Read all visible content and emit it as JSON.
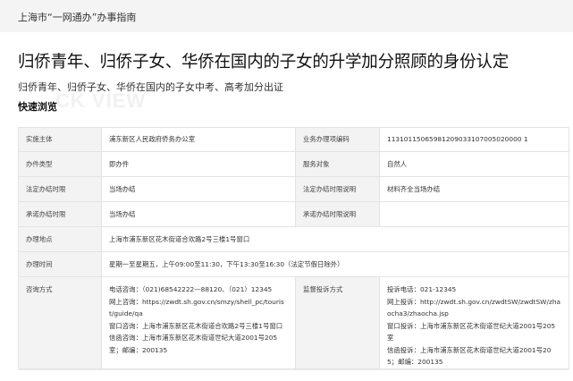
{
  "header": {
    "site_title": "上海市“一网通办”办事指南"
  },
  "page": {
    "title": "归侨青年、归侨子女、华侨在国内的子女的升学加分照顾的身份认定",
    "subtitle": "归侨青年、归侨子女、华侨在国内的子女中考、高考加分出证",
    "section_label": "快速浏览",
    "section_watermark": "CK VIEW"
  },
  "info": {
    "implementer_label": "实施主体",
    "implementer_value": "浦东新区人民政府侨务办公室",
    "code_label": "业务办理项编码",
    "code_value": "11310115065981209033107005020000 1",
    "type_label": "办件类型",
    "type_value": "即办件",
    "target_label": "服务对象",
    "target_value": "自然人",
    "legal_time_label": "法定办结时限",
    "legal_time_value": "当场办结",
    "legal_note_label": "法定办结时限说明",
    "legal_note_value": "材料齐全当场办结",
    "promise_time_label": "承诺办结时限",
    "promise_time_value": "当场办结",
    "promise_note_label": "承诺办结时限说明",
    "promise_note_value": "",
    "location_label": "办理地点",
    "location_value": "上海市浦东新区花木街道合欢路2号三楼1号窗口",
    "hours_label": "办理时间",
    "hours_value": "星期一至星期五，上午09:00至11:30，下午13:30至16:30（法定节假日除外）",
    "consult_label": "咨询方式",
    "consult_lines": [
      "电话咨询：（021)68542222—88120、（021）12345",
      "网上咨询：https://zwdt.sh.gov.cn/smzy/shell_pc/tourist/guide/qa",
      "窗口咨询：上海市浦东新区花木街道合欢路2号三楼1号窗口",
      "信函咨询：上海市浦东新区花木街道世纪大道2001号205室；邮编：200135"
    ],
    "complaint_label": "监督投诉方式",
    "complaint_lines": [
      "投诉电话：021-12345",
      "网上投诉：http://zwdt.sh.gov.cn/zwdtSW/zwdtSW/zhaocha3/zhaocha.jsp",
      "窗口投诉：上海市浦东新区花木街道世纪大道2001号205室",
      "信函投诉：上海市浦东新区花木街道世纪大道2001号205；邮编：200135"
    ]
  }
}
